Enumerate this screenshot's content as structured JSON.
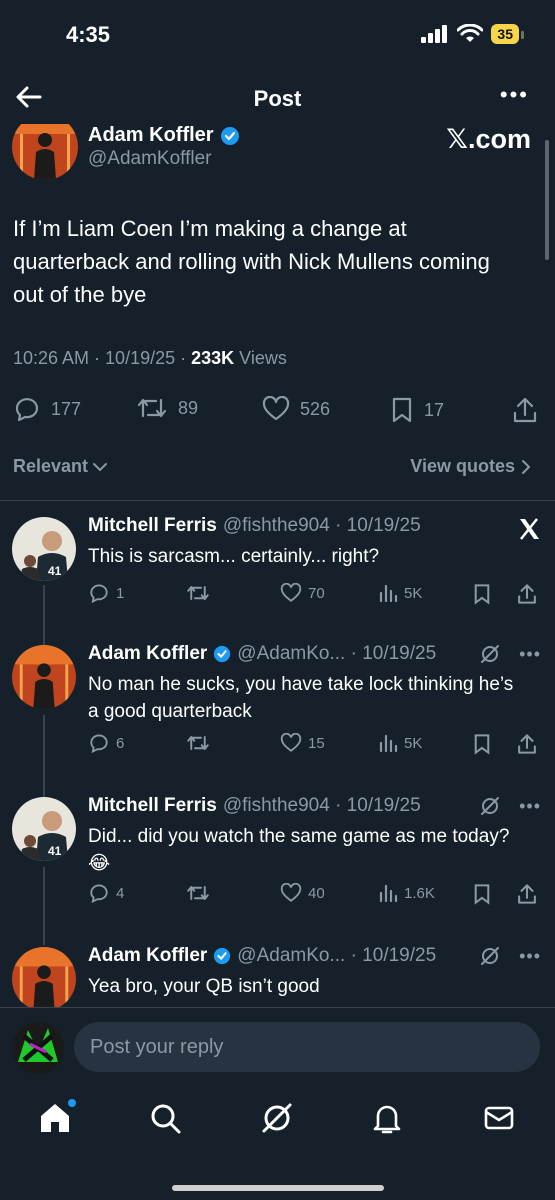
{
  "status_bar": {
    "time": "4:35",
    "battery": "35"
  },
  "header": {
    "title": "Post",
    "more": "•••"
  },
  "post": {
    "author_name": "Adam Koffler",
    "author_handle": "@AdamKoffler",
    "watermark": "𝕏.com",
    "text": "If I’m Liam Coen I’m making a change at quarterback and rolling with Nick Mullens coming out of the bye",
    "time": "10:26 AM · 10/19/25 · ",
    "views_count": "233K",
    "views_label": " Views",
    "replies": "177",
    "reposts": "89",
    "likes": "526",
    "bookmarks": "17"
  },
  "filters": {
    "sort_label": "Relevant",
    "view_quotes": "View quotes"
  },
  "replies": [
    {
      "name": "Mitchell Ferris",
      "handle": "@fishthe904 · 10/19/25",
      "text": "This is sarcasm... certainly... right?",
      "replies": "1",
      "reposts": "",
      "likes": "70",
      "views": "5K"
    },
    {
      "name": "Adam Koffler",
      "handle": "@AdamKo... · 10/19/25",
      "text": "No man he sucks, you have take lock thinking he’s a good quarterback",
      "replies": "6",
      "reposts": "",
      "likes": "15",
      "views": "5K"
    },
    {
      "name": "Mitchell Ferris",
      "handle": "@fishthe904 · 10/19/25",
      "text": "Did... did you watch the same game as me today? 😂",
      "replies": "4",
      "reposts": "",
      "likes": "40",
      "views": "1.6K"
    },
    {
      "name": "Adam Koffler",
      "handle": "@AdamKo... · 10/19/25",
      "text": "Yea bro, your QB isn’t good"
    }
  ],
  "reply_box": {
    "placeholder": "Post your reply"
  },
  "colors": {
    "background": "#15202b",
    "accent": "#1d9bf0",
    "muted": "#8b98a5",
    "battery": "#f7d44a"
  }
}
